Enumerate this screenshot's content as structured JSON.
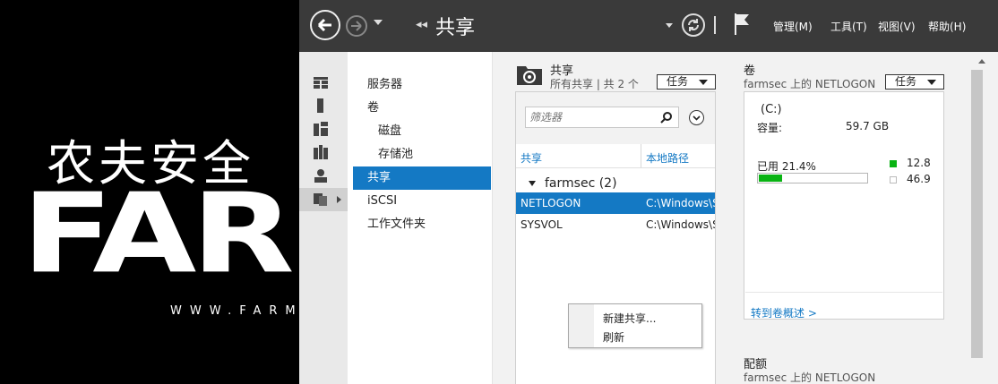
{
  "logo": {
    "cn_text": "农夫安全",
    "big_text": "FARM",
    "url_text": "WWW.FARM"
  },
  "titlebar": {
    "breadcrumb_arrows": "◂◂",
    "title": "共享",
    "menus": [
      "管理(M)",
      "工具(T)",
      "视图(V)",
      "帮助(H)"
    ]
  },
  "sidebar": {
    "icons": [
      "dashboard-icon",
      "local-server-icon",
      "all-servers-icon",
      "file-services-icon",
      "iis-icon",
      "file-storage-icon"
    ],
    "items": [
      {
        "label": "服务器",
        "indent": false,
        "selected": false
      },
      {
        "label": "卷",
        "indent": false,
        "selected": false
      },
      {
        "label": "磁盘",
        "indent": true,
        "selected": false
      },
      {
        "label": "存储池",
        "indent": true,
        "selected": false
      },
      {
        "label": "共享",
        "indent": false,
        "selected": true
      },
      {
        "label": "iSCSI",
        "indent": false,
        "selected": false
      },
      {
        "label": "工作文件夹",
        "indent": false,
        "selected": false
      }
    ]
  },
  "shares": {
    "title": "共享",
    "subtitle": "所有共享 | 共 2 个",
    "tasks_label": "任务",
    "filter_placeholder": "筛选器",
    "columns": [
      "共享",
      "本地路径"
    ],
    "group": "farmsec (2)",
    "rows": [
      {
        "name": "NETLOGON",
        "path": "C:\\Windows\\S",
        "selected": true
      },
      {
        "name": "SYSVOL",
        "path": "C:\\Windows\\S",
        "selected": false
      }
    ],
    "context_menu": [
      "新建共享...",
      "刷新"
    ]
  },
  "volume": {
    "title": "卷",
    "subtitle": "farmsec 上的 NETLOGON",
    "tasks_label": "任务",
    "drive": "(C:)",
    "capacity_label": "容量:",
    "capacity_value": "59.7 GB",
    "used_label": "已用 21.4%",
    "used_fraction": 0.214,
    "used_gb": "12.8",
    "free_gb": "46.9",
    "link": "转到卷概述 >",
    "used_color": "#09b313"
  },
  "quota": {
    "title": "配额",
    "subtitle": "farmsec 上的 NETLOGON"
  }
}
